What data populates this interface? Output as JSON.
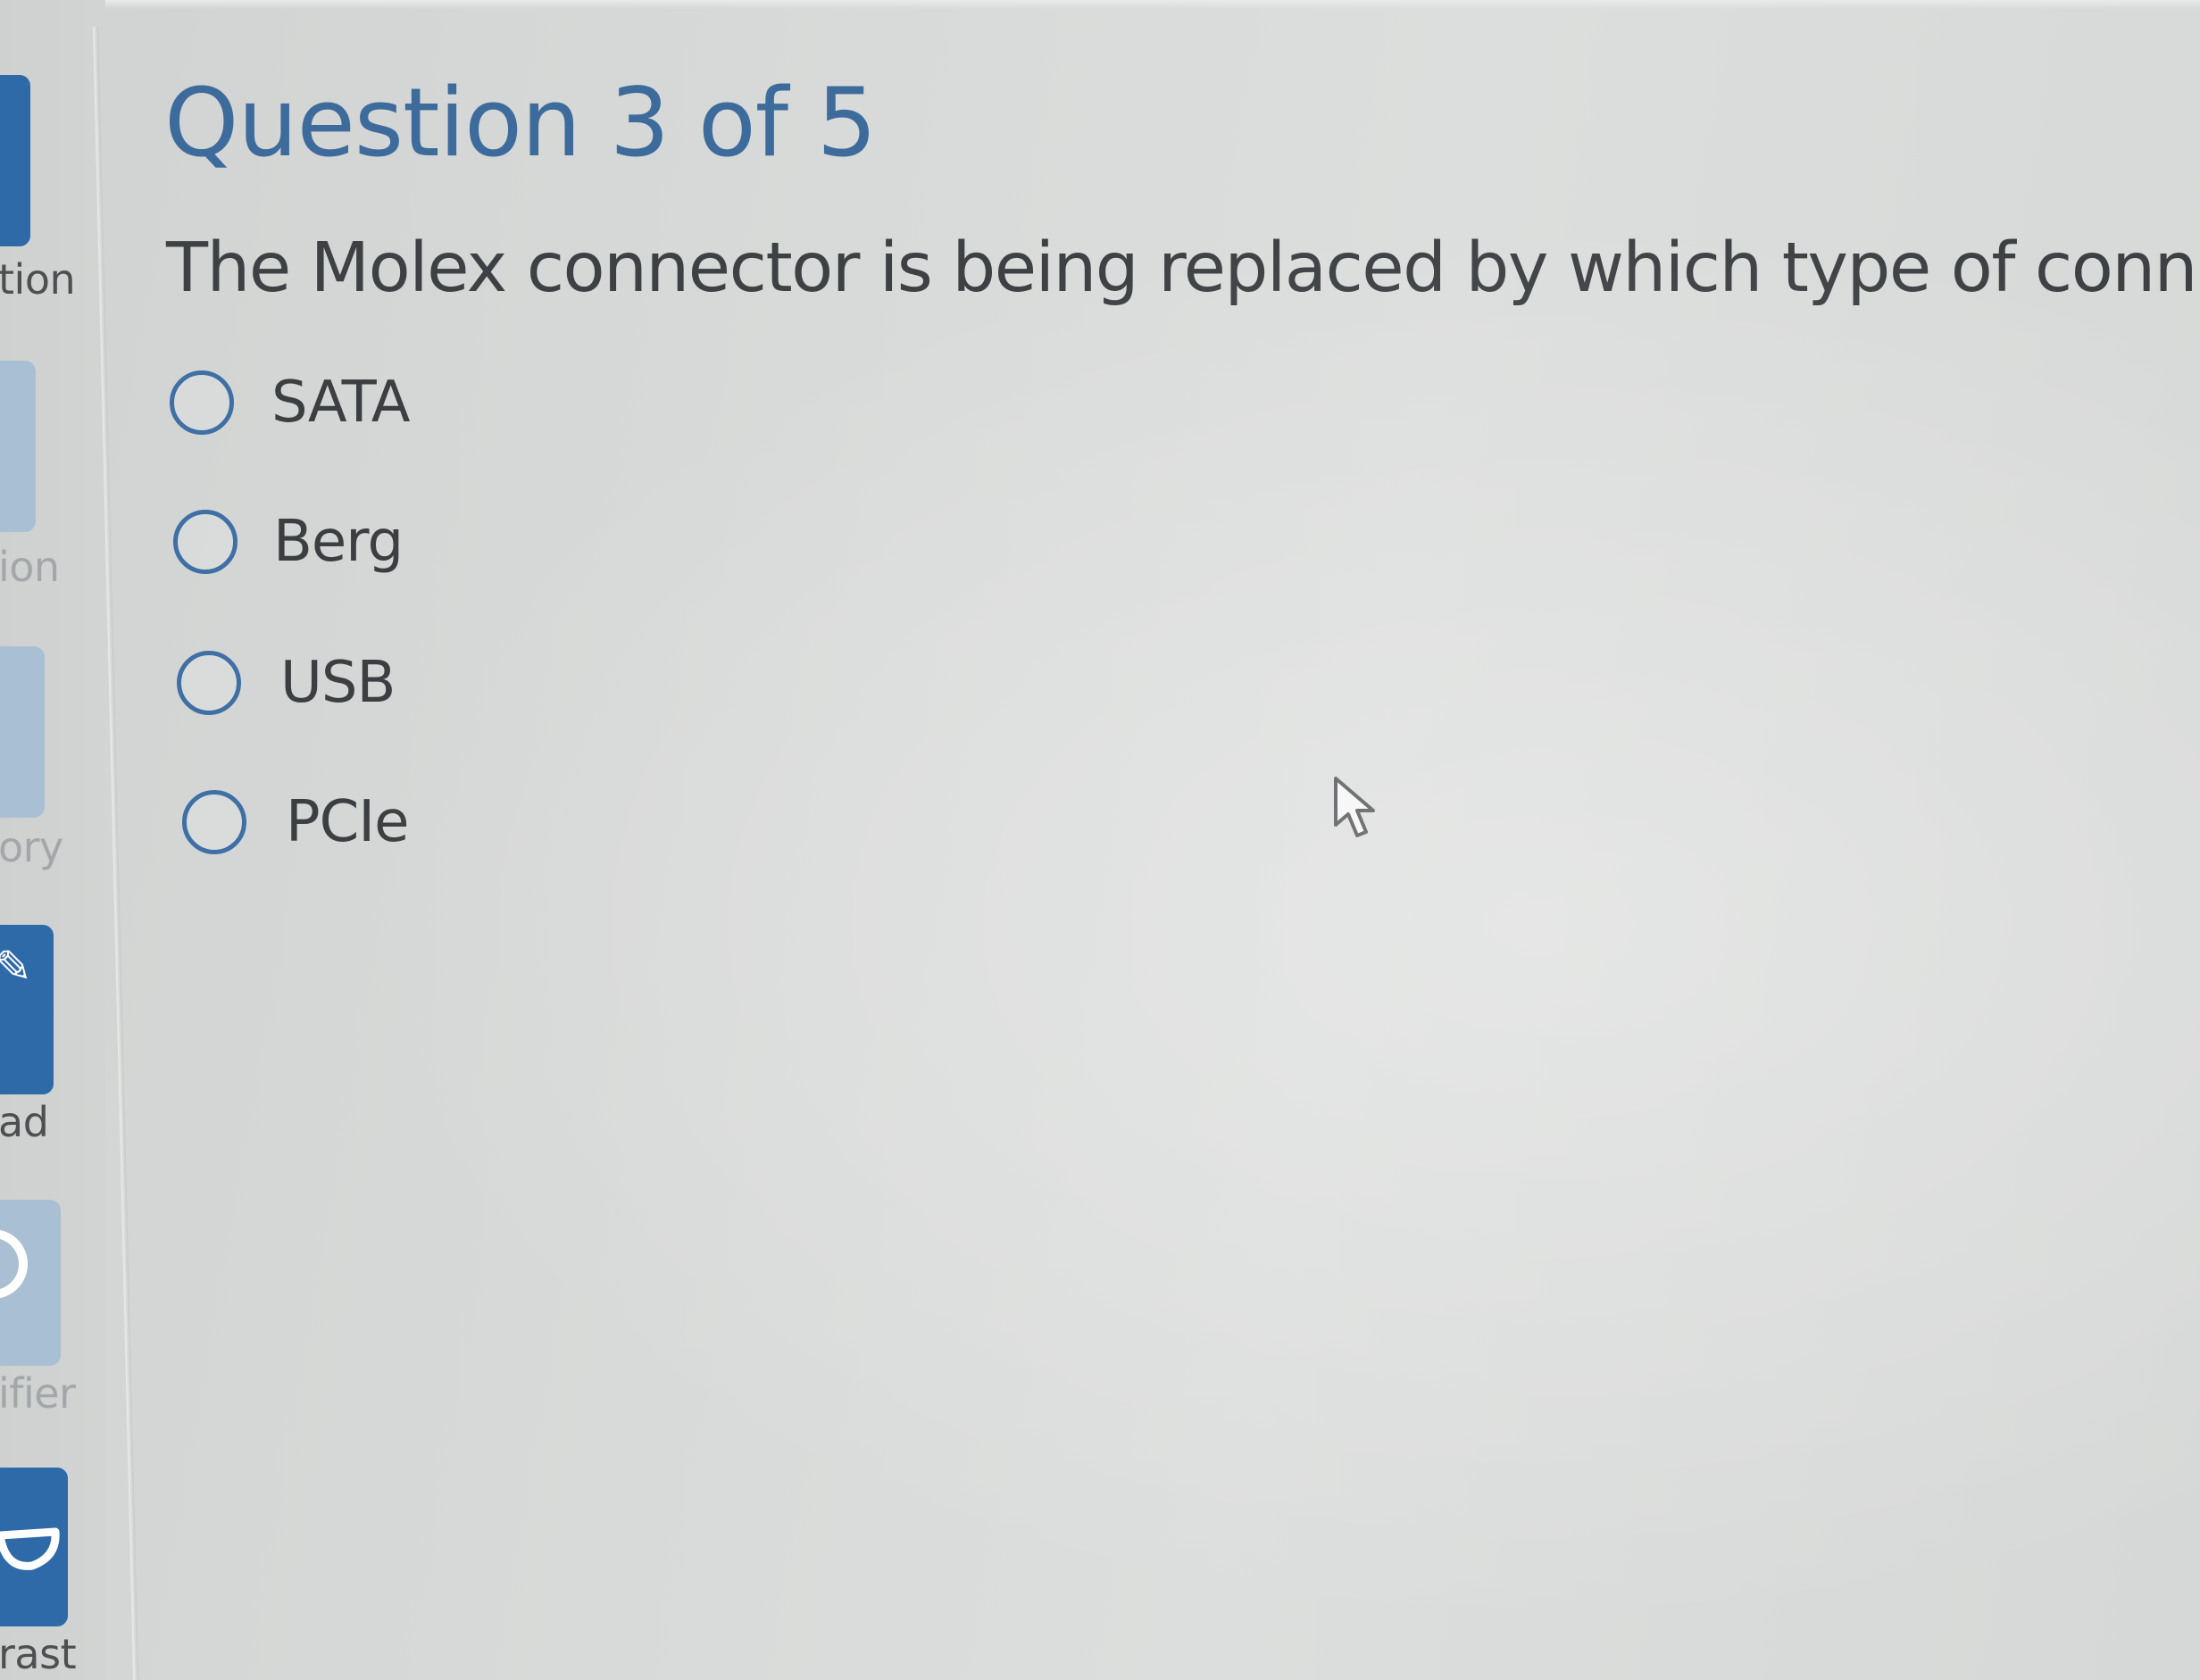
{
  "toolbar": {
    "items": [
      {
        "label": "tion",
        "icon": "tool-icon",
        "active": true
      },
      {
        "label": "ion",
        "icon": "tool-icon",
        "active": false
      },
      {
        "label": "ory",
        "icon": "tool-icon",
        "active": false
      },
      {
        "label": "ad",
        "icon": "pencil-icon",
        "active": true
      },
      {
        "label": "ifier",
        "icon": "magnifier-icon",
        "active": false
      },
      {
        "label": "rast",
        "icon": "contrast-icon",
        "active": true
      }
    ]
  },
  "quiz": {
    "heading": "Question 3 of 5",
    "question": "The Molex connector is being replaced by which type of connector?",
    "options": [
      {
        "label": "SATA",
        "selected": false
      },
      {
        "label": "Berg",
        "selected": false
      },
      {
        "label": "USB",
        "selected": false
      },
      {
        "label": "PCIe",
        "selected": false
      }
    ]
  },
  "colors": {
    "heading": "#3d6c9c",
    "radio_border": "#3f70a5",
    "toolbar_active": "#2f6aa8",
    "toolbar_inactive": "#a9bfd3",
    "body_text": "#3e4143"
  }
}
